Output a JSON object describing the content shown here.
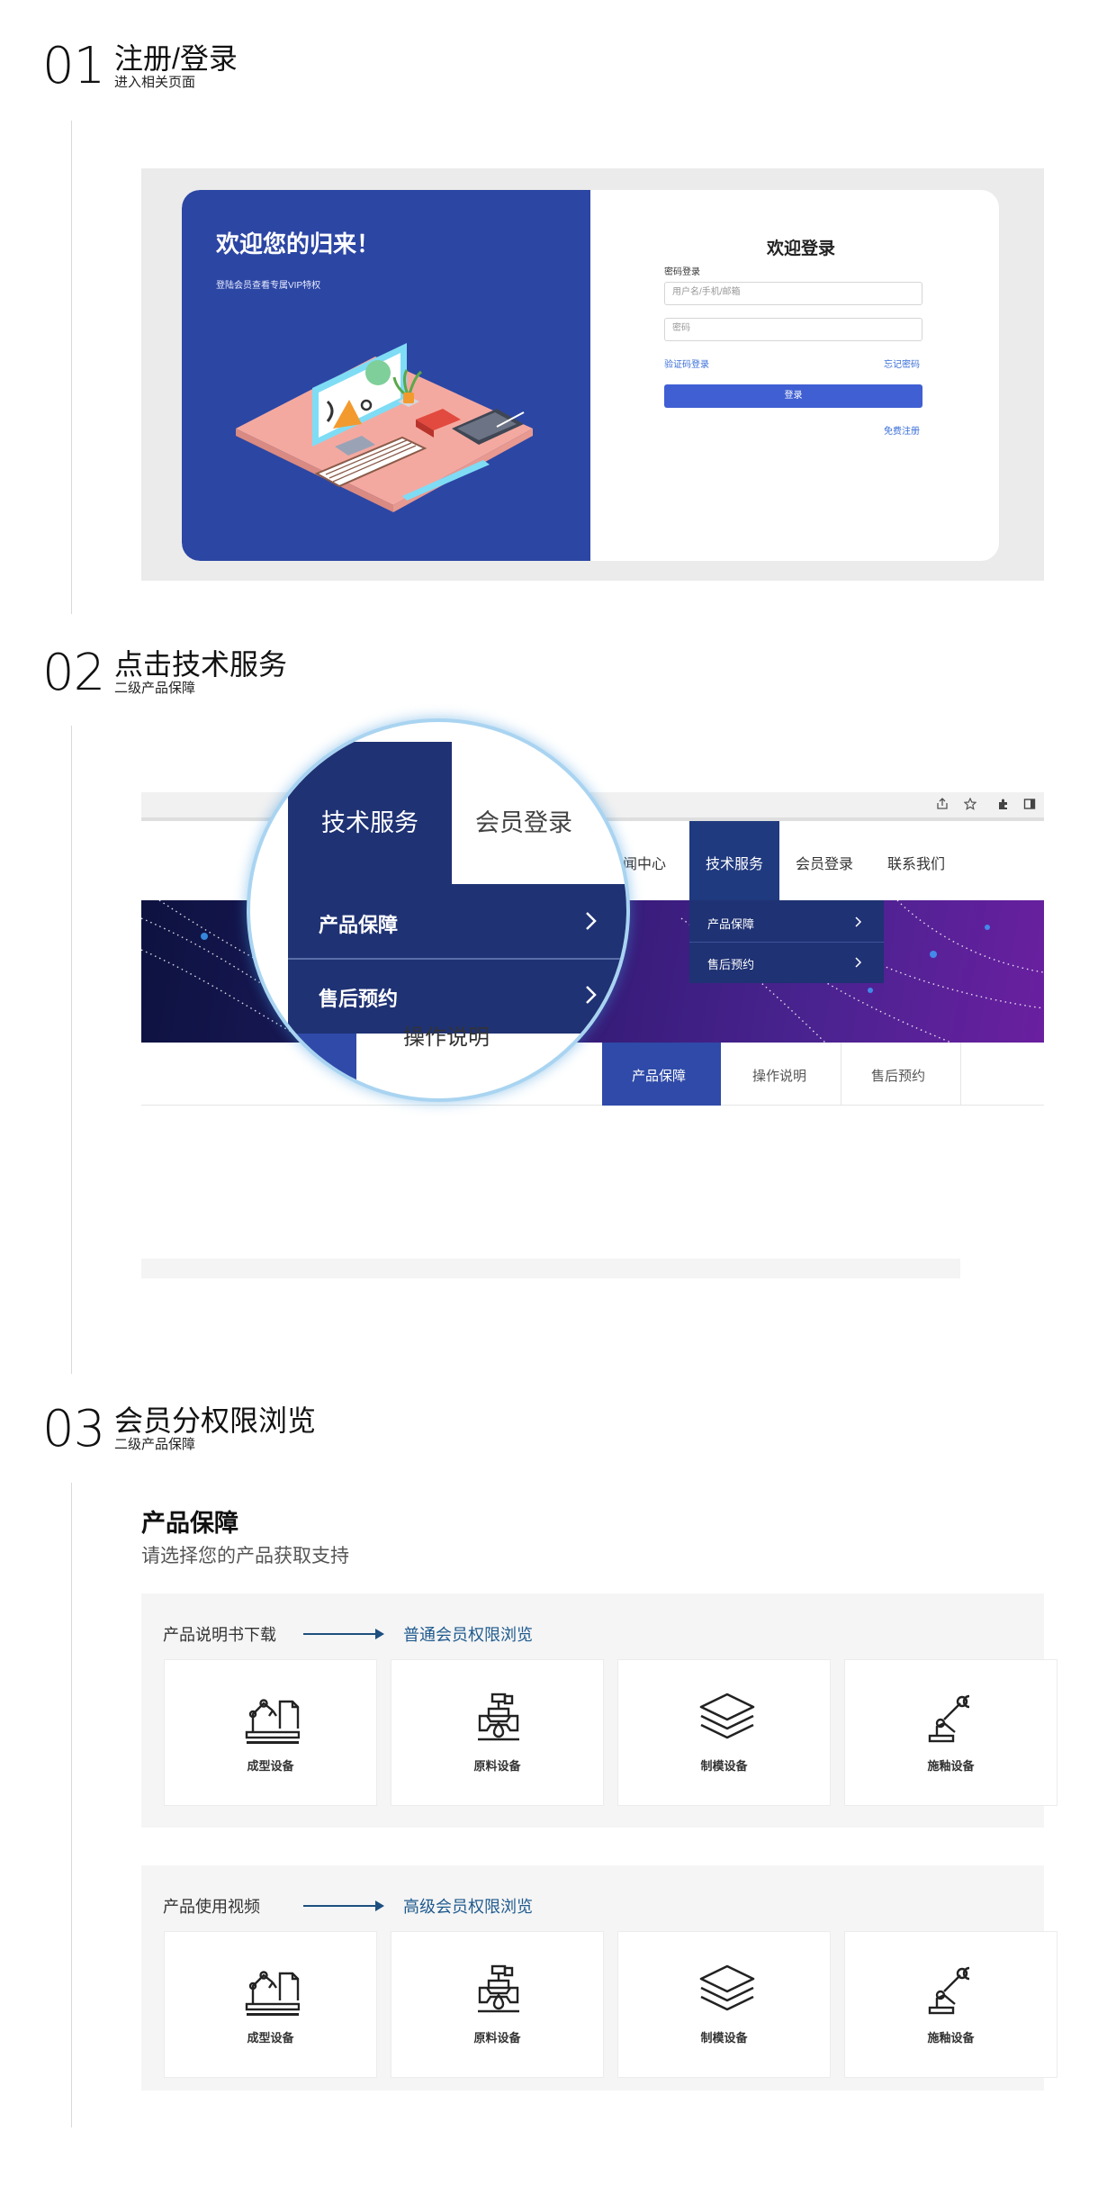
{
  "steps": [
    {
      "num": "01",
      "title": "注册/登录",
      "subtitle": "进入相关页面"
    },
    {
      "num": "02",
      "title": "点击技术服务",
      "subtitle": "二级产品保障"
    },
    {
      "num": "03",
      "title": "会员分权限浏览",
      "subtitle": "二级产品保障"
    }
  ],
  "login": {
    "welcome": "欢迎您的归来！",
    "vip_text": "登陆会员查看专属VIP特权",
    "form_title": "欢迎登录",
    "tab": "密码登录",
    "username_placeholder": "用户名/手机/邮箱",
    "password_placeholder": "密码",
    "code_login": "验证码登录",
    "forgot": "忘记密码",
    "submit": "登录",
    "register": "免费注册"
  },
  "site": {
    "nav": [
      "新闻中心",
      "技术服务",
      "会员登录",
      "联系我们"
    ],
    "dropdown": [
      "产品保障",
      "售后预约"
    ],
    "subnav": [
      "产品保障",
      "操作说明",
      "售后预约"
    ]
  },
  "magnifier": {
    "tab": "技术服务",
    "member": "会员登录",
    "items": [
      "产品保障",
      "售后预约"
    ],
    "bottom_text": "操作说明"
  },
  "products": {
    "heading": "产品保障",
    "subheading": "请选择您的产品获取支持",
    "panels": [
      {
        "label": "产品说明书下载",
        "access": "普通会员权限浏览",
        "cards": [
          "成型设备",
          "原料设备",
          "制模设备",
          "施釉设备"
        ]
      },
      {
        "label": "产品使用视频",
        "access": "高级会员权限浏览",
        "cards": [
          "成型设备",
          "原料设备",
          "制模设备",
          "施釉设备"
        ]
      }
    ]
  },
  "icons": [
    "arm-doc-icon",
    "valve-icon",
    "layers-icon",
    "robot-arm-icon",
    "share-icon",
    "star-icon",
    "puzzle-icon",
    "sidepanel-icon",
    "chevron-right-icon"
  ],
  "colors": {
    "brand_blue": "#2c46a4",
    "nav_dark": "#1f3274",
    "button": "#3f5fd3",
    "link": "#3a6fd8",
    "access_text": "#1f5a8e"
  }
}
